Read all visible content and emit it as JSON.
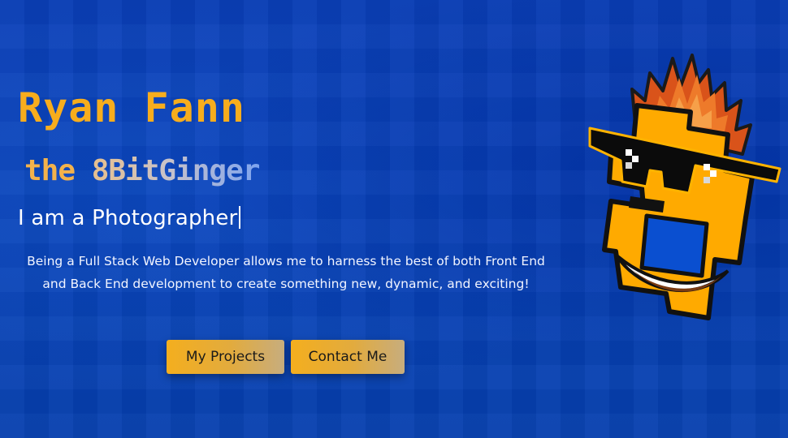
{
  "hero": {
    "name": "Ryan Fann",
    "handle_prefix": "the ",
    "handle_main": "8BitGinger",
    "typed_prefix": "I am a ",
    "typed_role": "Photographer",
    "blurb": "Being a Full Stack Web Developer allows me to harness the best of both Front End and Back End development to create something new, dynamic, and exciting!"
  },
  "buttons": {
    "projects_label": "My Projects",
    "contact_label": "Contact Me"
  },
  "colors": {
    "background": "#0744b6",
    "accent": "#f7ad1d",
    "text": "#ffffff",
    "mascot_body": "#ffaa00",
    "mascot_hair": "#e2581b"
  },
  "mascot": {
    "icon": "pixel-ginger-mascot-icon"
  }
}
